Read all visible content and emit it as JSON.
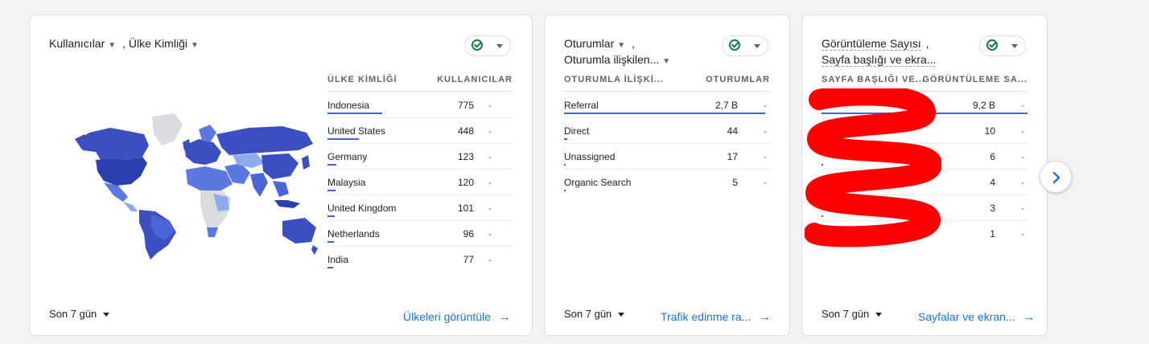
{
  "countries_card": {
    "title_part1": "Kullanıcılar",
    "title_part2": ", Ülke Kimliği",
    "col_dimension": "ÜLKE KİMLİĞİ",
    "col_metric": "KULLANICILAR",
    "rows": [
      {
        "label": "Indonesia",
        "value": "775",
        "change": "-",
        "share": 1.0
      },
      {
        "label": "United States",
        "value": "448",
        "change": "-",
        "share": 0.58
      },
      {
        "label": "Germany",
        "value": "123",
        "change": "-",
        "share": 0.16
      },
      {
        "label": "Malaysia",
        "value": "120",
        "change": "-",
        "share": 0.15
      },
      {
        "label": "United Kingdom",
        "value": "101",
        "change": "-",
        "share": 0.13
      },
      {
        "label": "Netherlands",
        "value": "96",
        "change": "-",
        "share": 0.12
      },
      {
        "label": "India",
        "value": "77",
        "change": "-",
        "share": 0.1
      }
    ],
    "date_range": "Son 7 gün",
    "link": "Ülkeleri görüntüle"
  },
  "sessions_card": {
    "title_line1": "Oturumlar",
    "title_comma": ",",
    "title_line2": "Oturumla ilişkilen...",
    "col_dimension": "OTURUMLA İLİŞKİ...",
    "col_metric": "OTURUMLAR",
    "rows": [
      {
        "label": "Referral",
        "value": "2,7 B",
        "change": "-",
        "share": 1.0
      },
      {
        "label": "Direct",
        "value": "44",
        "change": "-",
        "share": 0.016
      },
      {
        "label": "Unassigned",
        "value": "17",
        "change": "-",
        "share": 0.006
      },
      {
        "label": "Organic Search",
        "value": "5",
        "change": "-",
        "share": 0.002
      }
    ],
    "date_range": "Son 7 gün",
    "link": "Trafik edinme ra..."
  },
  "views_card": {
    "title_line1": "Görüntüleme Sayısı",
    "title_comma": ",",
    "title_line2": "Sayfa başlığı ve ekra...",
    "col_dimension": "SAYFA BAŞLIĞI VE...",
    "col_metric": "GÖRÜNTÜLEME SA...",
    "rows": [
      {
        "value": "9,2 B",
        "change": "-",
        "share": 1.0
      },
      {
        "value": "10",
        "change": "-",
        "share": 0.001
      },
      {
        "value": "6",
        "change": "-",
        "share": 0.0007
      },
      {
        "value": "4",
        "change": "-",
        "share": 0.0004
      },
      {
        "value": "3",
        "change": "-",
        "share": 0.0003
      },
      {
        "value": "1",
        "change": "-",
        "share": 0.0001
      }
    ],
    "date_range": "Son 7 gün",
    "link": "Sayfalar ve ekran..."
  },
  "colors": {
    "accent": "#1a73e8",
    "bar": "#4363d8",
    "check": "#188038",
    "map_dark": "#3c4fc0",
    "map_mid": "#5a78e0",
    "map_light": "#8fa9f0",
    "map_empty": "#dadce0",
    "redaction": "#ff0000"
  },
  "icons": {
    "check": "check-circle-icon",
    "caret": "caret-down-icon",
    "arrow": "arrow-right-icon",
    "next": "chevron-right-icon"
  }
}
